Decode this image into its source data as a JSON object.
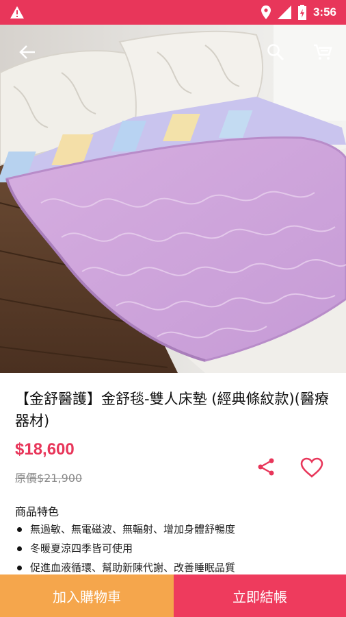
{
  "status_bar": {
    "time": "3:56",
    "network": "3G"
  },
  "product": {
    "title": "【金舒醫護】金舒毯-雙人床墊 (經典條紋款)(醫療器材)",
    "price": "$18,600",
    "original_price_label": "原價",
    "original_price": "$21,900"
  },
  "features": {
    "title": "商品特色",
    "items": [
      "無過敏、無電磁波、無輻射、增加身體舒暢度",
      "冬暖夏涼四季皆可使用",
      "促進血液循環、幫助新陳代謝、改善睡眠品質"
    ]
  },
  "actions": {
    "add_to_cart": "加入購物車",
    "buy_now": "立即結帳"
  },
  "icons": {
    "back": "arrow-left-icon",
    "search": "search-icon",
    "cart": "cart-icon",
    "share": "share-icon",
    "favorite": "heart-outline-icon",
    "warning": "warning-icon"
  },
  "colors": {
    "brand": "#e8365a",
    "cart_button": "#f5a64c",
    "buy_button": "#ee3b5d"
  }
}
